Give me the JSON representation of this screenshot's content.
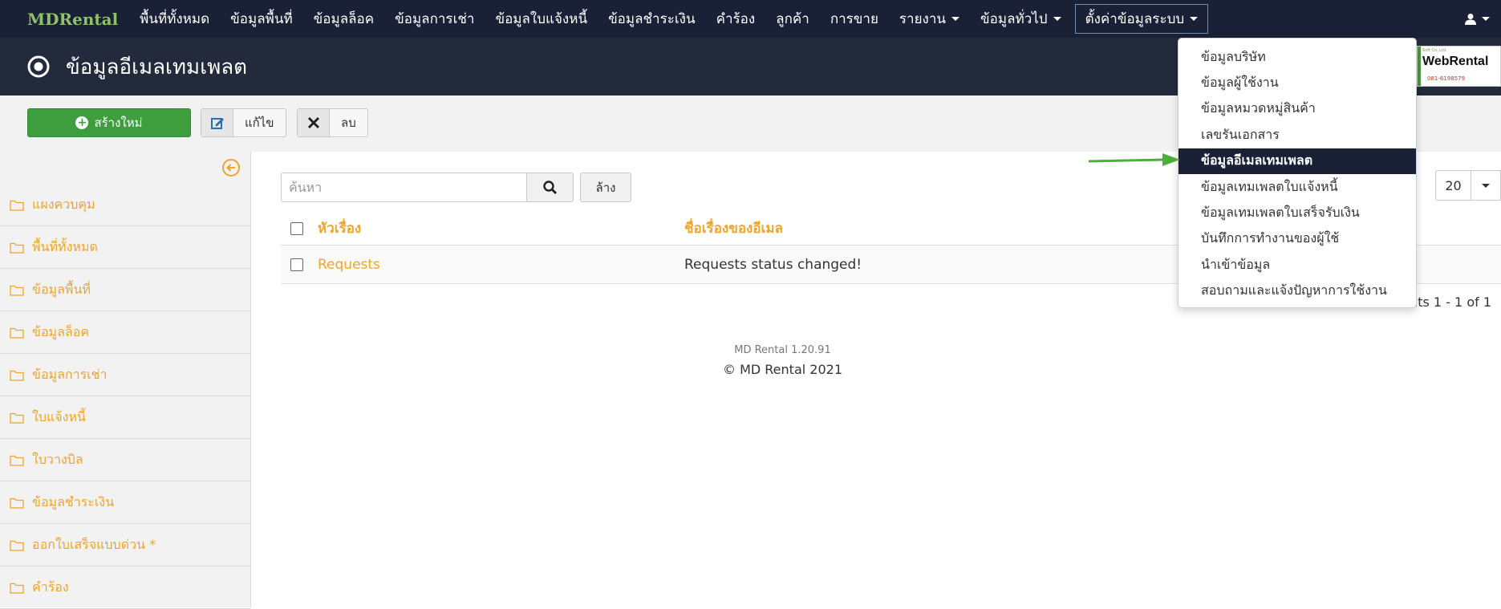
{
  "nav": {
    "brand": "MDRental",
    "items": [
      {
        "label": "พื้นที่ทั้งหมด",
        "dropdown": false
      },
      {
        "label": "ข้อมูลพื้นที่",
        "dropdown": false
      },
      {
        "label": "ข้อมูลล็อค",
        "dropdown": false
      },
      {
        "label": "ข้อมูลการเช่า",
        "dropdown": false
      },
      {
        "label": "ข้อมูลใบแจ้งหนี้",
        "dropdown": false
      },
      {
        "label": "ข้อมูลชำระเงิน",
        "dropdown": false
      },
      {
        "label": "คำร้อง",
        "dropdown": false
      },
      {
        "label": "ลูกค้า",
        "dropdown": false
      },
      {
        "label": "การขาย",
        "dropdown": false
      },
      {
        "label": "รายงาน",
        "dropdown": true
      },
      {
        "label": "ข้อมูลทั่วไป",
        "dropdown": true
      }
    ],
    "active_item": "ตั้งค่าข้อมูลระบบ"
  },
  "titlebar": {
    "title": "ข้อมูลอีเมลเทมเพลต",
    "logo_text": "WebRental",
    "logo_small": "Soft Co.,Ltd.",
    "logo_phone": "081-6198579"
  },
  "toolbar": {
    "create_label": "สร้างใหม่",
    "edit_label": "แก้ไข",
    "delete_label": "ลบ"
  },
  "sidebar": {
    "items": [
      "แผงควบคุม",
      "พื้นที่ทั้งหมด",
      "ข้อมูลพื้นที่",
      "ข้อมูลล็อค",
      "ข้อมูลการเช่า",
      "ใบแจ้งหนี้",
      "ใบวางบิล",
      "ข้อมูลชำระเงิน",
      "ออกใบเสร็จแบบด่วน *",
      "คำร้อง"
    ]
  },
  "search": {
    "placeholder": "ค้นหา",
    "clear_label": "ล้าง"
  },
  "table": {
    "headers": [
      "หัวเรื่อง",
      "ชื่อเรื่องของอีเมล"
    ],
    "rows": [
      {
        "subject": "Requests",
        "email_subject": "Requests status changed!"
      }
    ]
  },
  "pagination": {
    "page_size": "20",
    "results_text": "Results 1 - 1 of 1"
  },
  "footer": {
    "version": "MD Rental 1.20.91",
    "copyright": "© MD Rental 2021"
  },
  "dropdown": {
    "items": [
      {
        "label": "ข้อมูลบริษัท",
        "selected": false
      },
      {
        "label": "ข้อมูลผู้ใช้งาน",
        "selected": false
      },
      {
        "label": "ข้อมูลหมวดหมู่สินค้า",
        "selected": false
      },
      {
        "label": "เลขรันเอกสาร",
        "selected": false
      },
      {
        "label": "ข้อมูลอีเมลเทมเพลต",
        "selected": true
      },
      {
        "label": "ข้อมูลเทมเพลตใบแจ้งหนี้",
        "selected": false
      },
      {
        "label": "ข้อมูลเทมเพลตใบเสร็จรับเงิน",
        "selected": false
      },
      {
        "label": "บันทึกการทำงานของผู้ใช้",
        "selected": false
      },
      {
        "label": "นำเข้าข้อมูล",
        "selected": false
      },
      {
        "label": "สอบถามและแจ้งปัญหาการใช้งาน",
        "selected": false
      }
    ]
  },
  "colors": {
    "nav_bg": "#1a2035",
    "title_bg": "#232a3c",
    "accent_orange": "#f0a42a",
    "brand_green": "#8fc16a",
    "create_green": "#3e9e3e",
    "arrow_green": "#4caf3c"
  },
  "icons": [
    "target-icon",
    "plus-circle-icon",
    "edit-icon",
    "close-icon",
    "arrow-left-circle-icon",
    "folder-icon",
    "search-icon",
    "user-icon",
    "caret-down-icon",
    "arrow-right-icon"
  ]
}
